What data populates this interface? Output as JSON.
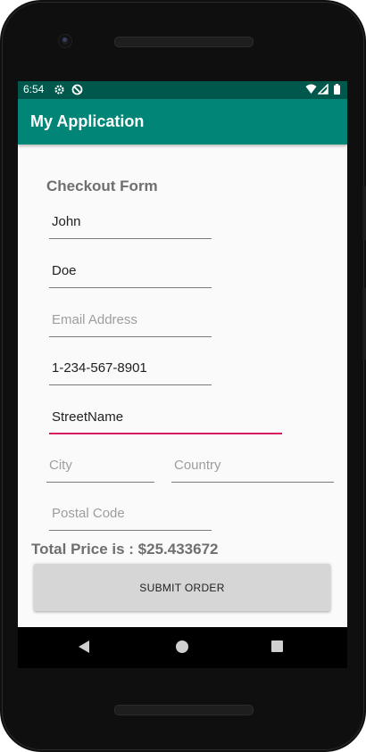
{
  "status_bar": {
    "time": "6:54",
    "icons": [
      "gear-icon",
      "do-not-disturb-icon",
      "wifi-icon",
      "signal-icon",
      "battery-icon"
    ]
  },
  "app_bar": {
    "title": "My Application"
  },
  "form": {
    "title": "Checkout Form",
    "first_name": {
      "value": "John",
      "placeholder": ""
    },
    "last_name": {
      "value": "Doe",
      "placeholder": ""
    },
    "email": {
      "value": "",
      "placeholder": "Email Address"
    },
    "phone": {
      "value": "1-234-567-8901",
      "placeholder": ""
    },
    "street": {
      "value": "StreetName",
      "placeholder": ""
    },
    "city": {
      "value": "",
      "placeholder": "City"
    },
    "country": {
      "value": "",
      "placeholder": "Country"
    },
    "postal_code": {
      "value": "",
      "placeholder": "Postal Code"
    }
  },
  "total_label": "Total Price is : $25.433672",
  "submit_label": "SUBMIT ORDER",
  "nav": {
    "icons": [
      "back-icon",
      "home-icon",
      "recents-icon"
    ]
  },
  "colors": {
    "status_bar": "#00574b",
    "app_bar": "#008577",
    "accent": "#d81b60"
  }
}
